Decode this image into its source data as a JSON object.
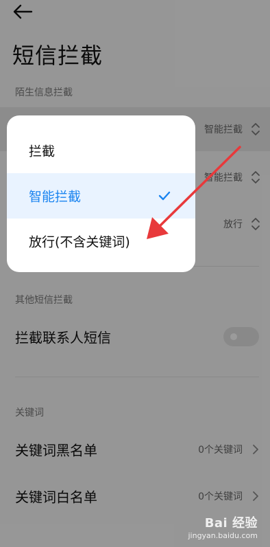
{
  "page": {
    "title": "短信拦截"
  },
  "sections": {
    "stranger": {
      "header": "陌生信息拦截",
      "rows": [
        {
          "label": "",
          "value": "智能拦截"
        },
        {
          "label": "",
          "value": "智能拦截"
        },
        {
          "label": "",
          "value": "放行"
        }
      ]
    },
    "other": {
      "header": "其他短信拦截",
      "toggle_row": {
        "label": "拦截联系人短信",
        "enabled": false
      }
    },
    "keywords": {
      "header": "关键词",
      "rows": [
        {
          "label": "关键词黑名单",
          "value": "0个关键词"
        },
        {
          "label": "关键词白名单",
          "value": "0个关键词"
        }
      ]
    }
  },
  "popup": {
    "options": [
      {
        "label": "拦截",
        "selected": false
      },
      {
        "label": "智能拦截",
        "selected": true
      },
      {
        "label": "放行(不含关键词)",
        "selected": false
      }
    ]
  },
  "watermark": {
    "logo": "Bai 经验",
    "url": "jingyan.baidu.com"
  },
  "colors": {
    "accent": "#1a84f0",
    "annotation_arrow": "#e8393b",
    "overlay": "rgba(0,0,0,0.38)"
  },
  "icons": {
    "back": "arrow-left-icon",
    "selector": "updown-chevron-icon",
    "navigate": "chevron-right-icon",
    "selected": "checkmark-icon"
  }
}
